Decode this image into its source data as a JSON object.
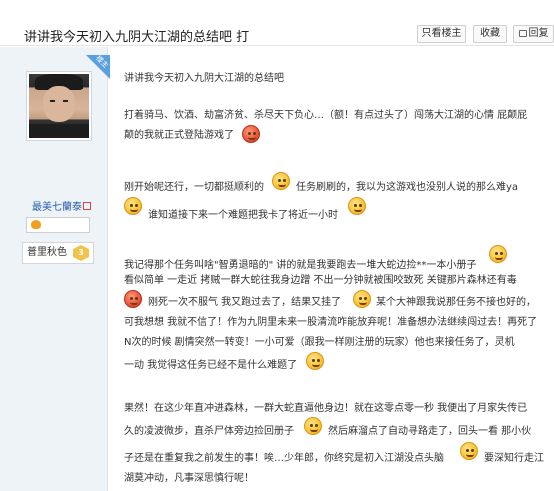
{
  "header": {
    "title": "讲讲我今天初入九阴大江湖的总结吧 打",
    "buttons": [
      "只看楼主",
      "收藏",
      "回复"
    ]
  },
  "sidebar": {
    "corner_badge": "楼主",
    "username": "最美七蘭泰",
    "user_tag": "⊠",
    "member_title": "普里秋色",
    "member_badge": "3"
  },
  "post": {
    "lines": [
      "讲讲我今天初入九阴大江湖的总结吧",
      "打着骑马、饮酒、劫富济贫、杀尽天下负心…（额！有点过头了）闯荡大江湖的心情 屁颠屁",
      "颠的我就正式登陆游戏了",
      "刚开始呢还行，一切都挺顺利的",
      "任务刷刷的，我以为这游戏也没别人说的那么难ya",
      "谁知道接下来一个难题把我卡了将近一小时",
      "我记得那个任务叫啥\"智勇退暗的\" 讲的就是我要跑去一堆大蛇边捡**一本小册子",
      "看似简单 一走近 拷贼一群大蛇往我身边蹭 不出一分钟就被围咬致死 关键那片森林还有毒",
      "刚死一次不服气 我又跑过去了，结果又挂了",
      "某个大神跟我说那任务不接也好的，",
      "可我想想 我就不信了！作为九阴里未来一股清流咋能放弃呢！准备想办法继续闯过去！再死了",
      "N次的时候 剧情突然一转变！一小可爱（跟我一样刚注册的玩家）他也来接任务了，灵机",
      "一动 我觉得这任务已经不是什么难题了",
      "果然！在这少年直冲进森林，一群大蛇直逼他身边！就在这零点零一秒 我便出了月家失传已",
      "久的凌波微步，直杀尸体旁边捡回册子",
      "然后麻溜点了自动寻路走了，回头一看 那小伙",
      "子还是在重复我之前发生的事！唉…少年郎，你终究是初入江湖没点头脑",
      "要深知行走江",
      "湖莫冲动，凡事深思慎行呢！"
    ]
  }
}
